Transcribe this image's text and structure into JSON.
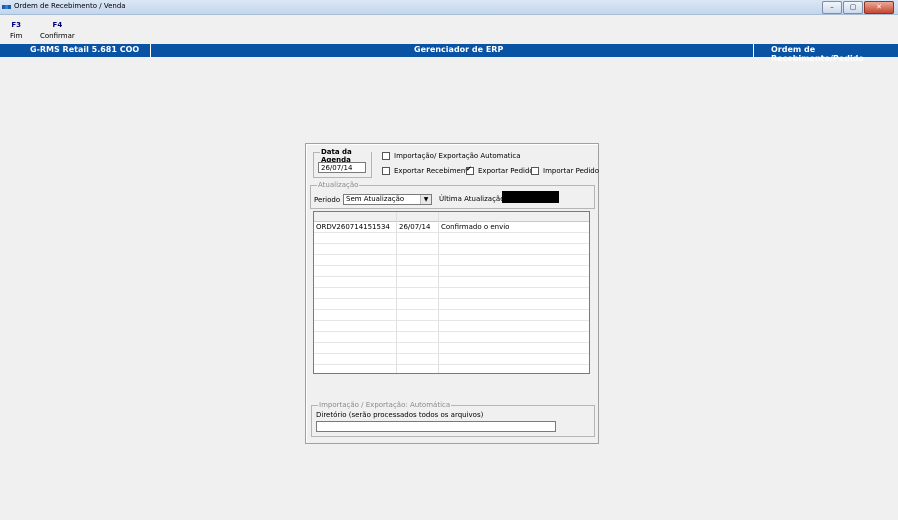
{
  "window": {
    "title": "Ordem de Recebimento / Venda",
    "controls": {
      "minimize": "–",
      "maximize": "▢",
      "close": "✕"
    }
  },
  "toolbar": {
    "items": [
      {
        "key": "F3",
        "label": "Fim"
      },
      {
        "key": "F4",
        "label": "Confirmar"
      }
    ]
  },
  "header_bar": {
    "left": "G-RMS Retail 5.681 COO",
    "center": "Gerenciador de ERP",
    "right": "Ordem de Recebimento/Pedido",
    "color": "#0a52a3"
  },
  "form": {
    "agenda_group": {
      "legend": "Data da Agenda",
      "date_value": "26/07/14"
    },
    "checkboxes": {
      "auto_import_export": {
        "label": "Importação/ Exportação Automatica",
        "checked": false
      },
      "export_receipt": {
        "label": "Exportar Recebimento",
        "checked": false
      },
      "export_order": {
        "label": "Exportar Pedido",
        "checked": true
      },
      "import_order": {
        "label": "Importar Pedido",
        "checked": false
      }
    },
    "update_group": {
      "legend": "Atualização",
      "period_label": "Periodo :",
      "period_value": "Sem Atualização",
      "last_update_label": "Última Atualização :",
      "last_update_value": ""
    },
    "grid": {
      "rows": [
        {
          "order": "ORDV260714151534",
          "date": "26/07/14",
          "status": "Confirmado o envio"
        }
      ]
    },
    "auto_group": {
      "legend": "Importação / Exportação: Automática",
      "dir_label": "Diretório (serão processados todos os arquivos)",
      "dir_value": ""
    }
  },
  "icons": {
    "app": "app-icon",
    "dropdown": "chevron-down-icon"
  }
}
